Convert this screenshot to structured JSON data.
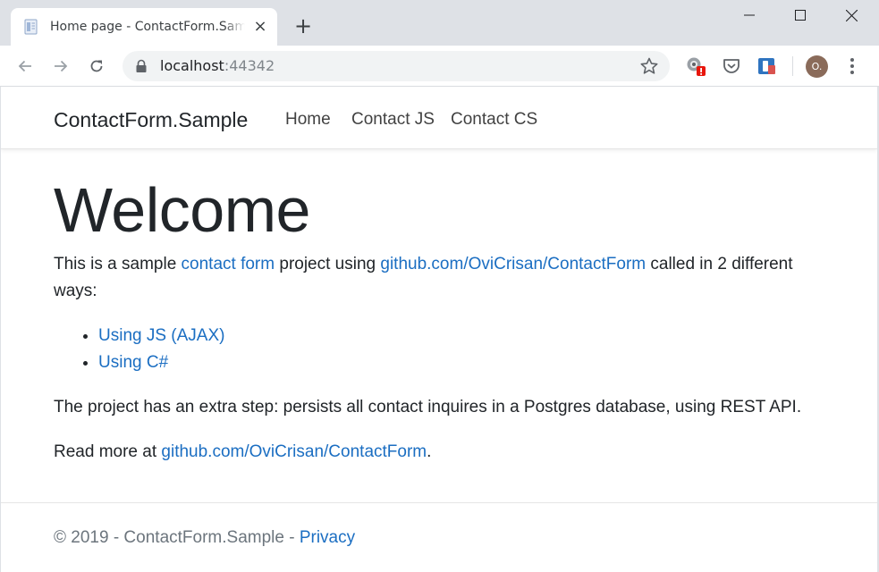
{
  "browser": {
    "tab_title": "Home page - ContactForm.Sample",
    "tab_close_glyph": "×",
    "new_tab_glyph": "+",
    "url_host": "localhost",
    "url_port": ":44342",
    "avatar_initial": "O.",
    "icons": {
      "favicon": "page-icon",
      "back": "arrow-left-icon",
      "forward": "arrow-right-icon",
      "reload": "reload-icon",
      "lock": "lock-icon",
      "bookmark": "star-icon",
      "menu": "kebab-menu-icon"
    },
    "colors": {
      "frame": "#dee1e6",
      "omnibox": "#f1f3f4",
      "alert_badge": "#e8160c",
      "avatar": "#8a6b5a"
    }
  },
  "site": {
    "brand": "ContactForm.Sample",
    "nav": [
      "Home",
      "Contact JS",
      "Contact CS"
    ],
    "link_color": "#1b6ec2"
  },
  "main": {
    "heading": "Welcome",
    "intro": {
      "t1": "This is a sample ",
      "link1": "contact form",
      "t2": " project using ",
      "link2": "github.com/OviCrisan/ContactForm",
      "t3": " called in 2 different ways:"
    },
    "ways": [
      "Using JS (AJAX)",
      "Using C#"
    ],
    "extra": "The project has an extra step: persists all contact inquires in a Postgres database, using REST API.",
    "read_more": {
      "t1": "Read more at ",
      "link": "github.com/OviCrisan/ContactForm",
      "t2": "."
    }
  },
  "footer": {
    "text": "© 2019 - ContactForm.Sample - ",
    "privacy": "Privacy"
  }
}
